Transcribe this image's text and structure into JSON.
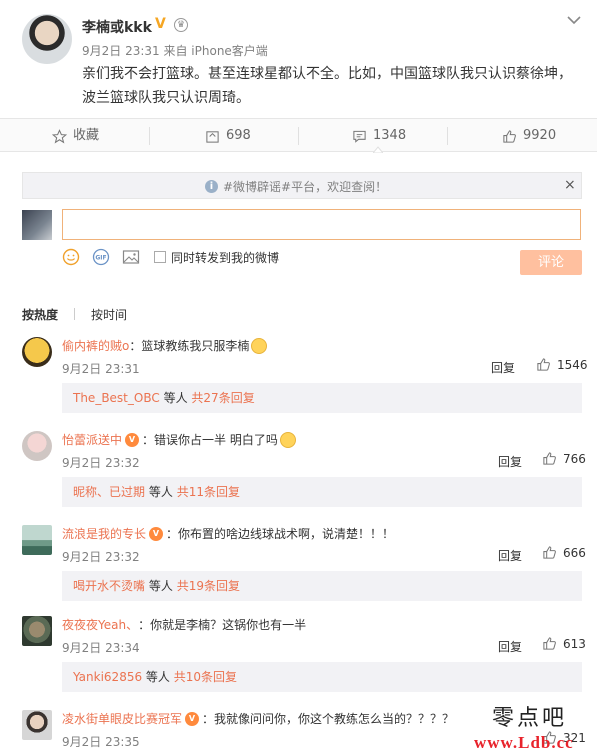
{
  "post": {
    "author": "李楠或kkk",
    "verified_badge": "V",
    "meta": "9月2日 23:31 来自 iPhone客户端",
    "text": "亲们我不会打篮球。甚至连球星都认不全。比如，中国篮球队我只认识蔡徐坤，波兰篮球队我只认识周琦。"
  },
  "actions": {
    "favorite": "收藏",
    "repost": "698",
    "comment": "1348",
    "like": "9920"
  },
  "notice": {
    "text": "#微博辟谣#平台，欢迎查阅！",
    "close": "×"
  },
  "composer": {
    "placeholder": "",
    "forward_label": "同时转发到我的微博",
    "submit_label": "评论"
  },
  "sort": {
    "hot": "按热度",
    "time": "按时间"
  },
  "comments": [
    {
      "user": "偷内裤的贼o",
      "text": "：篮球教练我只服李楠",
      "has_badge": false,
      "date": "9月2日 23:31",
      "reply": "回复",
      "likes": "1546",
      "sub_user": "The_Best_OBC",
      "sub_mid": "等人",
      "sub_count": "共27条回复"
    },
    {
      "user": "怡蕾派送中",
      "text": "：错误你占一半 明白了吗",
      "has_badge": true,
      "date": "9月2日 23:32",
      "reply": "回复",
      "likes": "766",
      "sub_user": "昵称、已过期",
      "sub_mid": "等人",
      "sub_count": "共11条回复"
    },
    {
      "user": "流浪是我的专长",
      "text": "：你布置的啥边线球战术啊，说清楚！！！",
      "has_badge": true,
      "date": "9月2日 23:32",
      "reply": "回复",
      "likes": "666",
      "sub_user": "喝开水不烫嘴",
      "sub_mid": "等人",
      "sub_count": "共19条回复"
    },
    {
      "user": "夜夜夜Yeah、",
      "text": "：你就是李楠？这锅你也有一半",
      "has_badge": false,
      "date": "9月2日 23:34",
      "reply": "回复",
      "likes": "613",
      "sub_user": "Yanki62856",
      "sub_mid": "等人",
      "sub_count": "共10条回复"
    },
    {
      "user": "凌水街单眼皮比赛冠军",
      "text": "：我就像问问你，你这个教练怎么当的？？？？",
      "has_badge": true,
      "date": "9月2日 23:35",
      "reply": "回复",
      "likes": "321"
    }
  ],
  "watermark": {
    "brand": "零点吧",
    "url": "www.Ldb.cc"
  },
  "colors": {
    "link": "#eb7350",
    "submit_disabled": "#ffc09f",
    "input_border": "#f0b27a"
  }
}
